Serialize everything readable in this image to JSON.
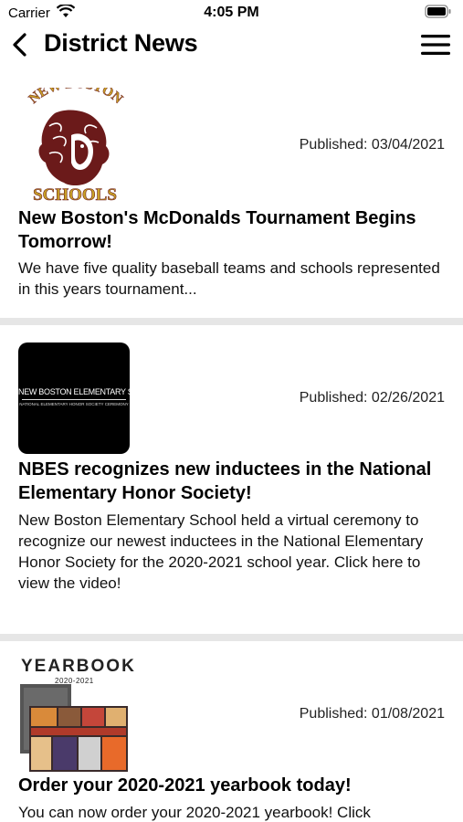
{
  "status": {
    "carrier": "Carrier",
    "time": "4:05 PM"
  },
  "nav": {
    "title": "District News"
  },
  "articles": [
    {
      "logo_top": "NEW BOSTON",
      "logo_bottom": "SCHOOLS",
      "published": "Published: 03/04/2021",
      "title": "New Boston's McDonalds Tournament Begins Tomorrow!",
      "body": " We have five quality baseball teams and schools represented in this years tournament..."
    },
    {
      "thumb_line1": "NEW BOSTON ELEMENTARY SCHOOL",
      "thumb_line2": "NATIONAL ELEMENTARY HONOR SOCIETY CEREMONY",
      "published": "Published: 02/26/2021",
      "title": "NBES recognizes new inductees in the National Elementary Honor Society!",
      "body": "New Boston Elementary School held a virtual ceremony to recognize our newest inductees in the National Elementary Honor Society for the 2020-2021 school year.  Click here to view the video!"
    },
    {
      "thumb_title": "YEARBOOK",
      "thumb_year": "2020-2021",
      "published": "Published: 01/08/2021",
      "title": "Order your 2020-2021 yearbook today!",
      "body": "You can now order your 2020-2021 yearbook!  Click"
    }
  ],
  "colors": {
    "logo_maroon": "#6b1a1a",
    "logo_gold": "#c9a227",
    "divider": "#e6e6e6"
  }
}
